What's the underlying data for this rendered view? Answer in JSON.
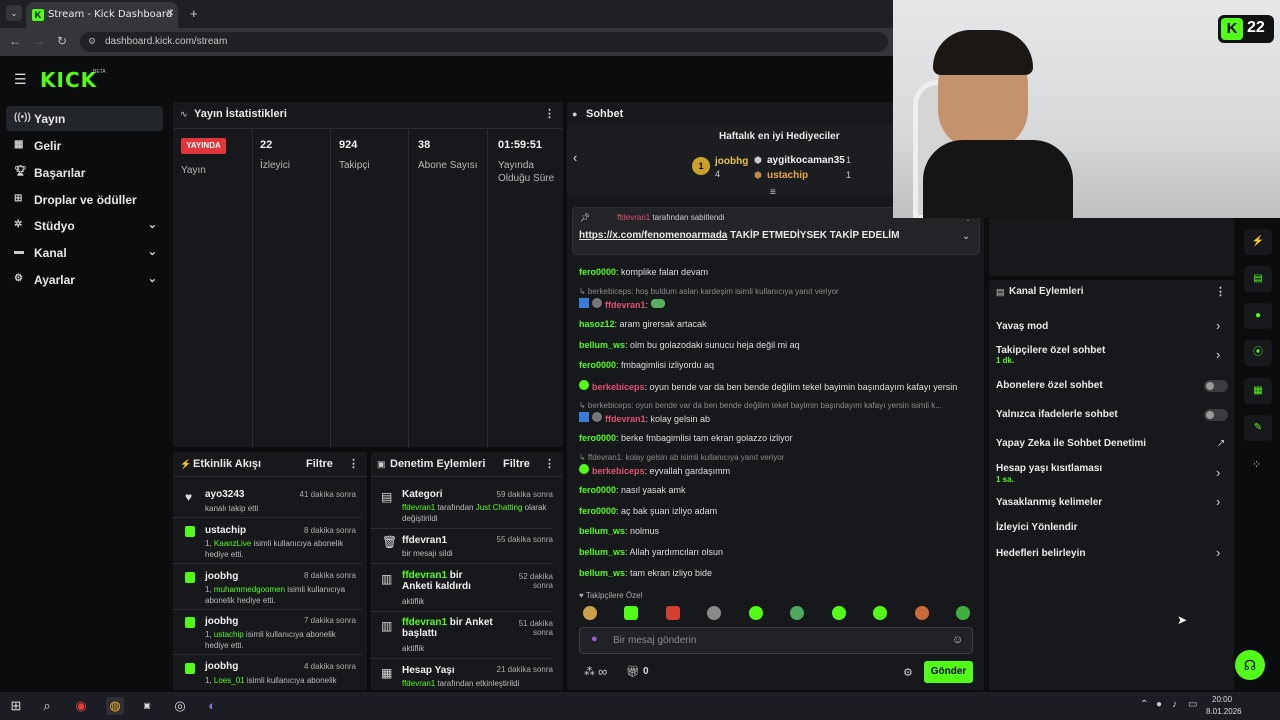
{
  "browser": {
    "tab_title": "Stream - Kick Dashboard",
    "url": "dashboard.kick.com/stream",
    "favicon_letter": "K"
  },
  "header": {
    "logo": "KICK",
    "logo_badge": "BETA"
  },
  "sidebar": {
    "items": [
      {
        "label": "Yayın",
        "icon": "broadcast-icon"
      },
      {
        "label": "Gelir",
        "icon": "revenue-icon"
      },
      {
        "label": "Başarılar",
        "icon": "trophy-icon"
      },
      {
        "label": "Droplar ve ödüller",
        "icon": "drops-icon"
      },
      {
        "label": "Stüdyo",
        "icon": "studio-icon"
      },
      {
        "label": "Kanal",
        "icon": "channel-icon"
      },
      {
        "label": "Ayarlar",
        "icon": "gear-icon"
      }
    ]
  },
  "stats": {
    "title": "Yayın İstatistikleri",
    "live_badge": "YAYINDA",
    "live_label": "Yayın",
    "viewers": "22",
    "viewers_label": "İzleyici",
    "followers": "924",
    "followers_label": "Takipçi",
    "subs": "38",
    "subs_label": "Abone Sayısı",
    "uptime": "01:59:51",
    "uptime_label": "Yayında Olduğu Süre"
  },
  "activity": {
    "title": "Etkinlik Akışı",
    "filter": "Filtre",
    "items": [
      {
        "name": "ayo3243",
        "time": "41 dakika sonra",
        "desc": "kanalı takip etti"
      },
      {
        "name": "ustachip",
        "time": "8 dakika sonra",
        "desc_prefix": "1, ",
        "desc_hl": "KaanzLive",
        "desc_suffix": " isimli kullanıcıya abonelik hediye etti."
      },
      {
        "name": "joobhg",
        "time": "8 dakika sonra",
        "desc_prefix": "1, ",
        "desc_hl": "muhammedgoomen",
        "desc_suffix": " isimli kullanıcıya abonelik hediye etti."
      },
      {
        "name": "joobhg",
        "time": "7 dakika sonra",
        "desc_prefix": "1, ",
        "desc_hl": "ustachip",
        "desc_suffix": " isimli kullanıcıya abonelik hediye etti."
      },
      {
        "name": "joobhg",
        "time": "4 dakika sonra",
        "desc_prefix": "1, ",
        "desc_hl": "Loes_01",
        "desc_suffix": " isimli kullanıcıya abonelik"
      }
    ]
  },
  "moderation": {
    "title": "Denetim Eylemleri",
    "filter": "Filtre",
    "items": [
      {
        "name": "Kategori",
        "time": "59 dakika sonra",
        "d1": "ffdevran1",
        "d2": " tarafından ",
        "d3": "Just Chatting",
        "d4": " olarak değiştirildi"
      },
      {
        "name": "ffdevran1",
        "time": "55 dakika sonra",
        "d1": "bir mesajı sildi"
      },
      {
        "name_hl": "ffdevran1",
        "name_rest": " bir Anketi kaldırdı",
        "time": "52 dakika sonra",
        "d1": "aktiflik"
      },
      {
        "name_hl": "ffdevran1",
        "name_rest": " bir Anket başlattı",
        "time": "51 dakika sonra",
        "d1": "aktiflik"
      },
      {
        "name": "Hesap Yaşı",
        "time": "21 dakika sonra",
        "d1": "ffdevran1",
        "d2": " tarafından etkinleştirildi"
      }
    ]
  },
  "chat": {
    "title": "Sohbet",
    "gifters_title": "Haftalık en iyi Hediyeciler",
    "gifters": [
      {
        "rank": "1",
        "name": "joobhg",
        "count": "4"
      },
      {
        "name": "aygitkocaman35",
        "count": "1"
      },
      {
        "name": "ustachip",
        "count": "1"
      }
    ],
    "pinned_by": "ffdevran1",
    "pinned_suffix": " tarafından sabitlendi",
    "pinned_link": "https://x.com/fenomenoarmada",
    "pinned_text": " TAKİP ETMEDİYSEK TAKİP EDELİM",
    "messages": [
      {
        "u": "fero0000",
        "t": ": komplike falan devam"
      },
      {
        "reply": "↳ berkebiceps: hoş buldum aslan kardeşim isimli kullanıcıya yanıt veriyor"
      },
      {
        "u_red": "ffdevran1",
        "t": ":"
      },
      {
        "u": "hasoz12",
        "t": ": aram girersak artacak"
      },
      {
        "u": "bellum_ws",
        "t": ": olm bu golazodaki sunucu heja değil mi aq"
      },
      {
        "u": "fero0000",
        "t": ": fmbagimlisi izliyordu aq"
      },
      {
        "u": "berkebiceps",
        "t": ": oyun bende var da ben bende değilim tekel bayimin başındayım kafayı yersin"
      },
      {
        "reply": "↳ berkebiceps: oyun bende var da ben bende değilim tekel bayimin başındayım kafayı yersin isimli k..."
      },
      {
        "u_red": "ffdevran1",
        "t": ": kolay gelsin ab"
      },
      {
        "u": "fero0000",
        "t": ": berke fmbagimlisi tam ekran golazzo izliyor"
      },
      {
        "reply": "↳ ffdevran1: kolay gelsin ab isimli kullanıcıya yanıt veriyor"
      },
      {
        "u": "berkebiceps",
        "t": ": eyvallah gardaşımm"
      },
      {
        "u": "fero0000",
        "t": ": nasıl yasak amk"
      },
      {
        "u": "fero0000",
        "t": ": aç bak şuan izliyo adam"
      },
      {
        "u": "bellum_ws",
        "t": ": nolmus"
      },
      {
        "u": "bellum_ws",
        "t": ": Allah yardımcıları olsun"
      },
      {
        "u": "bellum_ws",
        "t": ": tam ekran izliyo bide"
      }
    ],
    "followers_only": "Takipçilere Özel",
    "input_placeholder": "Bir mesaj gönderin",
    "points": "∞",
    "gift_count": "0",
    "send": "Gönder"
  },
  "actions": {
    "title": "Kanal Eylemleri",
    "items": [
      {
        "label": "Yavaş mod",
        "type": "arrow"
      },
      {
        "label": "Takipçilere özel sohbet",
        "sub": "1 dk.",
        "type": "arrow"
      },
      {
        "label": "Abonelere özel sohbet",
        "type": "toggle"
      },
      {
        "label": "Yalnızca ifadelerle sohbet",
        "type": "toggle"
      },
      {
        "label": "Yapay Zeka ile Sohbet Denetimi",
        "type": "external"
      },
      {
        "label": "Hesap yaşı kısıtlaması",
        "sub": "1 sa.",
        "type": "arrow"
      },
      {
        "label": "Yasaklanmış kelimeler",
        "type": "arrow"
      },
      {
        "label": "İzleyici Yönlendir",
        "type": "none"
      },
      {
        "label": "Hedefleri belirleyin",
        "type": "arrow"
      }
    ]
  },
  "webcam": {
    "badge_count": "22",
    "badge_letter": "K"
  },
  "taskbar": {
    "time": "20:00",
    "date": "8.01.2026"
  },
  "colors": {
    "accent": "#53fc18",
    "live": "#e0353a",
    "panel": "#17181b"
  }
}
